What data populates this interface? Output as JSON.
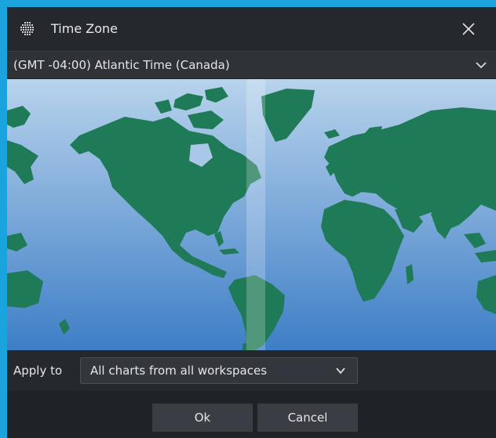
{
  "window": {
    "title": "Time Zone",
    "icon": "grid-app-icon",
    "close_icon": "close-icon"
  },
  "timezone": {
    "selected": "(GMT -04:00) Atlantic Time (Canada)",
    "chevron_icon": "chevron-down-icon"
  },
  "map": {
    "land_color": "#1f7a57",
    "ocean_top_color": "#b8d3ec",
    "ocean_bottom_color": "#3e7ec6",
    "highlight_band": "selected-timezone-band"
  },
  "apply": {
    "label": "Apply to",
    "selected": "All charts from all workspaces",
    "chevron_icon": "chevron-down-icon"
  },
  "buttons": {
    "ok": "Ok",
    "cancel": "Cancel"
  },
  "colors": {
    "frame": "#1aa3dc",
    "dialog_bg": "#25292e",
    "button_bg": "#3a3e44"
  }
}
